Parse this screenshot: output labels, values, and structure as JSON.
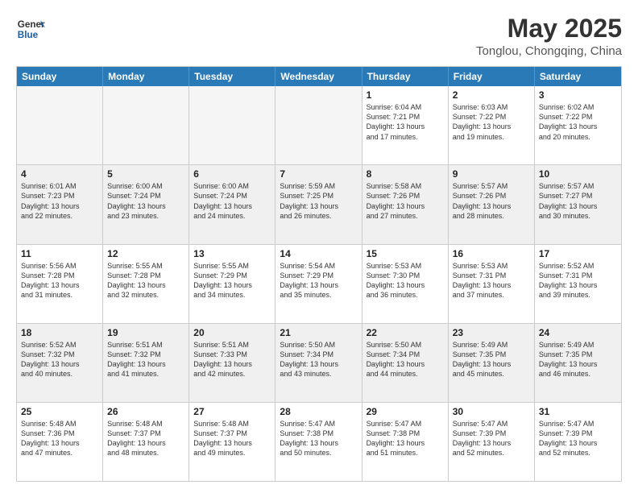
{
  "header": {
    "logo_general": "General",
    "logo_blue": "Blue",
    "main_title": "May 2025",
    "sub_title": "Tonglou, Chongqing, China"
  },
  "calendar": {
    "days_of_week": [
      "Sunday",
      "Monday",
      "Tuesday",
      "Wednesday",
      "Thursday",
      "Friday",
      "Saturday"
    ],
    "rows": [
      [
        {
          "day": "",
          "info": "",
          "empty": true
        },
        {
          "day": "",
          "info": "",
          "empty": true
        },
        {
          "day": "",
          "info": "",
          "empty": true
        },
        {
          "day": "",
          "info": "",
          "empty": true
        },
        {
          "day": "1",
          "info": "Sunrise: 6:04 AM\nSunset: 7:21 PM\nDaylight: 13 hours\nand 17 minutes."
        },
        {
          "day": "2",
          "info": "Sunrise: 6:03 AM\nSunset: 7:22 PM\nDaylight: 13 hours\nand 19 minutes."
        },
        {
          "day": "3",
          "info": "Sunrise: 6:02 AM\nSunset: 7:22 PM\nDaylight: 13 hours\nand 20 minutes."
        }
      ],
      [
        {
          "day": "4",
          "info": "Sunrise: 6:01 AM\nSunset: 7:23 PM\nDaylight: 13 hours\nand 22 minutes."
        },
        {
          "day": "5",
          "info": "Sunrise: 6:00 AM\nSunset: 7:24 PM\nDaylight: 13 hours\nand 23 minutes."
        },
        {
          "day": "6",
          "info": "Sunrise: 6:00 AM\nSunset: 7:24 PM\nDaylight: 13 hours\nand 24 minutes."
        },
        {
          "day": "7",
          "info": "Sunrise: 5:59 AM\nSunset: 7:25 PM\nDaylight: 13 hours\nand 26 minutes."
        },
        {
          "day": "8",
          "info": "Sunrise: 5:58 AM\nSunset: 7:26 PM\nDaylight: 13 hours\nand 27 minutes."
        },
        {
          "day": "9",
          "info": "Sunrise: 5:57 AM\nSunset: 7:26 PM\nDaylight: 13 hours\nand 28 minutes."
        },
        {
          "day": "10",
          "info": "Sunrise: 5:57 AM\nSunset: 7:27 PM\nDaylight: 13 hours\nand 30 minutes."
        }
      ],
      [
        {
          "day": "11",
          "info": "Sunrise: 5:56 AM\nSunset: 7:28 PM\nDaylight: 13 hours\nand 31 minutes."
        },
        {
          "day": "12",
          "info": "Sunrise: 5:55 AM\nSunset: 7:28 PM\nDaylight: 13 hours\nand 32 minutes."
        },
        {
          "day": "13",
          "info": "Sunrise: 5:55 AM\nSunset: 7:29 PM\nDaylight: 13 hours\nand 34 minutes."
        },
        {
          "day": "14",
          "info": "Sunrise: 5:54 AM\nSunset: 7:29 PM\nDaylight: 13 hours\nand 35 minutes."
        },
        {
          "day": "15",
          "info": "Sunrise: 5:53 AM\nSunset: 7:30 PM\nDaylight: 13 hours\nand 36 minutes."
        },
        {
          "day": "16",
          "info": "Sunrise: 5:53 AM\nSunset: 7:31 PM\nDaylight: 13 hours\nand 37 minutes."
        },
        {
          "day": "17",
          "info": "Sunrise: 5:52 AM\nSunset: 7:31 PM\nDaylight: 13 hours\nand 39 minutes."
        }
      ],
      [
        {
          "day": "18",
          "info": "Sunrise: 5:52 AM\nSunset: 7:32 PM\nDaylight: 13 hours\nand 40 minutes."
        },
        {
          "day": "19",
          "info": "Sunrise: 5:51 AM\nSunset: 7:32 PM\nDaylight: 13 hours\nand 41 minutes."
        },
        {
          "day": "20",
          "info": "Sunrise: 5:51 AM\nSunset: 7:33 PM\nDaylight: 13 hours\nand 42 minutes."
        },
        {
          "day": "21",
          "info": "Sunrise: 5:50 AM\nSunset: 7:34 PM\nDaylight: 13 hours\nand 43 minutes."
        },
        {
          "day": "22",
          "info": "Sunrise: 5:50 AM\nSunset: 7:34 PM\nDaylight: 13 hours\nand 44 minutes."
        },
        {
          "day": "23",
          "info": "Sunrise: 5:49 AM\nSunset: 7:35 PM\nDaylight: 13 hours\nand 45 minutes."
        },
        {
          "day": "24",
          "info": "Sunrise: 5:49 AM\nSunset: 7:35 PM\nDaylight: 13 hours\nand 46 minutes."
        }
      ],
      [
        {
          "day": "25",
          "info": "Sunrise: 5:48 AM\nSunset: 7:36 PM\nDaylight: 13 hours\nand 47 minutes."
        },
        {
          "day": "26",
          "info": "Sunrise: 5:48 AM\nSunset: 7:37 PM\nDaylight: 13 hours\nand 48 minutes."
        },
        {
          "day": "27",
          "info": "Sunrise: 5:48 AM\nSunset: 7:37 PM\nDaylight: 13 hours\nand 49 minutes."
        },
        {
          "day": "28",
          "info": "Sunrise: 5:47 AM\nSunset: 7:38 PM\nDaylight: 13 hours\nand 50 minutes."
        },
        {
          "day": "29",
          "info": "Sunrise: 5:47 AM\nSunset: 7:38 PM\nDaylight: 13 hours\nand 51 minutes."
        },
        {
          "day": "30",
          "info": "Sunrise: 5:47 AM\nSunset: 7:39 PM\nDaylight: 13 hours\nand 52 minutes."
        },
        {
          "day": "31",
          "info": "Sunrise: 5:47 AM\nSunset: 7:39 PM\nDaylight: 13 hours\nand 52 minutes."
        }
      ]
    ]
  }
}
